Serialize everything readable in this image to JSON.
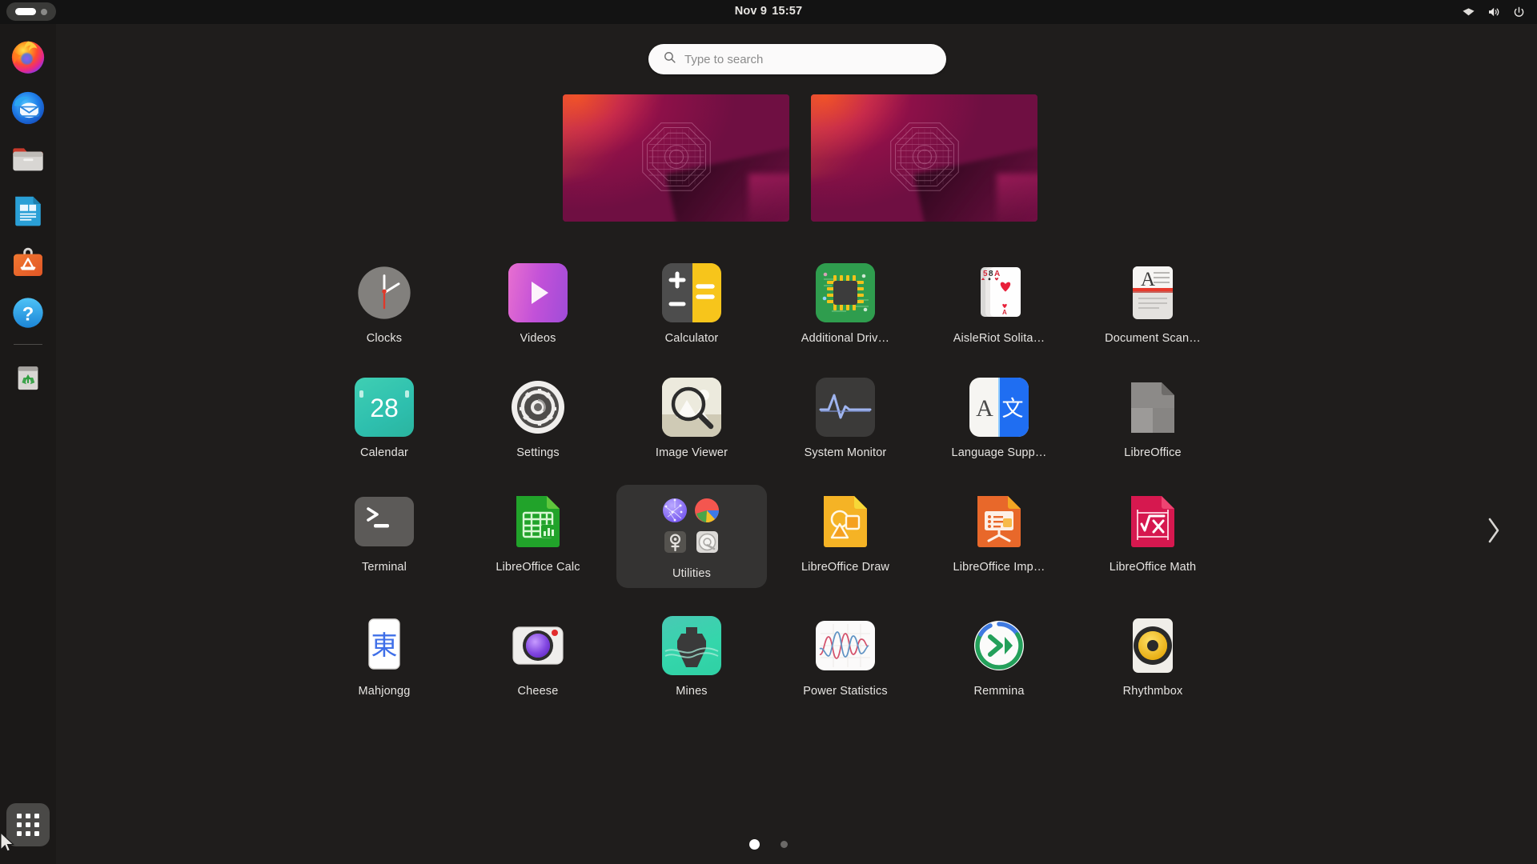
{
  "topbar": {
    "activities_label": "Activities",
    "clock": "Nov 9  15:57",
    "clock_date": "Nov 9",
    "clock_time": "15:57",
    "status": [
      {
        "name": "wifi-icon",
        "label": "Wi-Fi"
      },
      {
        "name": "volume-icon",
        "label": "Volume"
      },
      {
        "name": "power-icon",
        "label": "Power / System menu"
      }
    ]
  },
  "search": {
    "placeholder": "Type to search",
    "value": "",
    "icon": "search-icon"
  },
  "workspaces": {
    "count": 2,
    "items": [
      {
        "name": "workspace-thumbnail-1",
        "label": "Workspace 1",
        "active": true
      },
      {
        "name": "workspace-thumbnail-2",
        "label": "Workspace 2",
        "active": false
      }
    ]
  },
  "dock": {
    "items": [
      {
        "name": "dock-item-firefox",
        "label": "Firefox",
        "icon": "firefox-icon"
      },
      {
        "name": "dock-item-thunderbird",
        "label": "Thunderbird Mail",
        "icon": "thunderbird-icon"
      },
      {
        "name": "dock-item-files",
        "label": "Files",
        "icon": "files-folder-icon"
      },
      {
        "name": "dock-item-libreoffice-writer",
        "label": "LibreOffice Writer",
        "icon": "libreoffice-writer-icon"
      },
      {
        "name": "dock-item-ubuntu-software",
        "label": "Ubuntu Software",
        "icon": "ubuntu-software-icon"
      },
      {
        "name": "dock-item-help",
        "label": "Help",
        "icon": "help-question-icon"
      },
      {
        "name": "dock-item-trash",
        "label": "Trash",
        "icon": "trash-recycle-icon"
      }
    ],
    "show_apps": {
      "name": "show-applications-button",
      "label": "Show Applications",
      "icon": "grid-apps-icon"
    }
  },
  "appgrid": {
    "rows": [
      [
        {
          "label": "Clocks",
          "icon": "clocks-icon",
          "folder": false
        },
        {
          "label": "Videos",
          "icon": "videos-icon",
          "folder": false
        },
        {
          "label": "Calculator",
          "icon": "calculator-icon",
          "folder": false
        },
        {
          "label": "Additional Driv…",
          "icon": "additional-drivers-icon",
          "folder": false
        },
        {
          "label": "AisleRiot Solita…",
          "icon": "aisleriot-solitaire-icon",
          "folder": false
        },
        {
          "label": "Document Scan…",
          "icon": "document-scanner-icon",
          "folder": false
        }
      ],
      [
        {
          "label": "Calendar",
          "icon": "calendar-icon",
          "folder": false,
          "badge": "28"
        },
        {
          "label": "Settings",
          "icon": "settings-gear-icon",
          "folder": false
        },
        {
          "label": "Image Viewer",
          "icon": "image-viewer-icon",
          "folder": false
        },
        {
          "label": "System Monitor",
          "icon": "system-monitor-icon",
          "folder": false
        },
        {
          "label": "Language Supp…",
          "icon": "language-support-icon",
          "folder": false
        },
        {
          "label": "LibreOffice",
          "icon": "libreoffice-main-icon",
          "folder": false
        }
      ],
      [
        {
          "label": "Terminal",
          "icon": "terminal-icon",
          "folder": false
        },
        {
          "label": "LibreOffice Calc",
          "icon": "libreoffice-calc-icon",
          "folder": false
        },
        {
          "label": "Utilities",
          "icon": "utilities-folder-icon",
          "folder": true
        },
        {
          "label": "LibreOffice Draw",
          "icon": "libreoffice-draw-icon",
          "folder": false
        },
        {
          "label": "LibreOffice Imp…",
          "icon": "libreoffice-impress-icon",
          "folder": false
        },
        {
          "label": "LibreOffice Math",
          "icon": "libreoffice-math-icon",
          "folder": false
        }
      ],
      [
        {
          "label": "Mahjongg",
          "icon": "mahjongg-icon",
          "folder": false,
          "glyph": "東"
        },
        {
          "label": "Cheese",
          "icon": "cheese-camera-icon",
          "folder": false
        },
        {
          "label": "Mines",
          "icon": "mines-icon",
          "folder": false
        },
        {
          "label": "Power Statistics",
          "icon": "power-statistics-icon",
          "folder": false
        },
        {
          "label": "Remmina",
          "icon": "remmina-icon",
          "folder": false
        },
        {
          "label": "Rhythmbox",
          "icon": "rhythmbox-icon",
          "folder": false
        }
      ]
    ],
    "utilities_folder_previews": [
      {
        "name": "network-globe-icon",
        "label": "Connections"
      },
      {
        "name": "disk-usage-pie-icon",
        "label": "Disk Usage Analyzer"
      },
      {
        "name": "passwords-keys-icon",
        "label": "Passwords and Keys"
      },
      {
        "name": "disks-drive-icon",
        "label": "Disks"
      }
    ],
    "next_page": {
      "name": "next-page-arrow",
      "label": "Next page",
      "icon": "chevron-right-icon"
    },
    "pages": [
      {
        "label": "Page 1",
        "active": true
      },
      {
        "label": "Page 2",
        "active": false
      }
    ]
  },
  "colors": {
    "background": "#1f1d1c",
    "topbar": "#131313",
    "dock": "#1b1918",
    "folder_tile": "#343332",
    "text": "#e6e4e1",
    "search_bg": "#fbfafa",
    "wallpaper_magenta": "#8d1048",
    "wallpaper_orange": "#e8402a",
    "accent_active_dot": "#ffffff"
  }
}
